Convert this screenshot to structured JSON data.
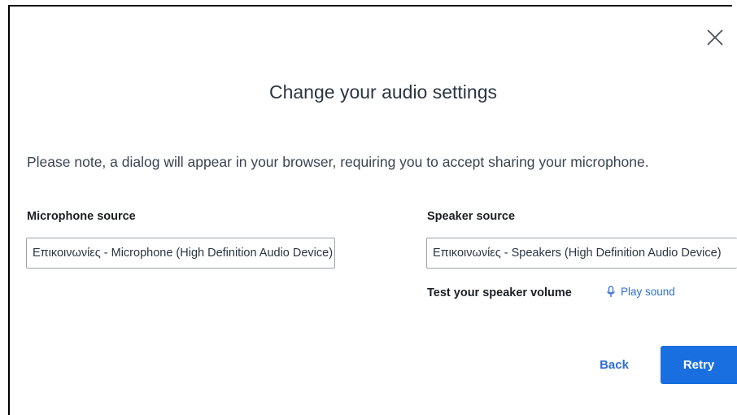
{
  "dialog": {
    "title": "Change your audio settings",
    "note": "Please note, a dialog will appear in your browser, requiring you to accept sharing your microphone."
  },
  "microphone": {
    "label": "Microphone source",
    "selected": "Επικοινωνίες - Microphone (High Definition Audio Device)"
  },
  "speaker": {
    "label": "Speaker source",
    "selected": "Επικοινωνίες - Speakers (High Definition Audio Device)",
    "test_label": "Test your speaker volume",
    "play_label": "Play sound"
  },
  "actions": {
    "back_label": "Back",
    "retry_label": "Retry"
  },
  "icons": {
    "close": "close-icon",
    "play": "microphone-icon"
  },
  "colors": {
    "accent": "#1a6fe0",
    "link": "#2f6fd6",
    "text": "#2b3542"
  }
}
